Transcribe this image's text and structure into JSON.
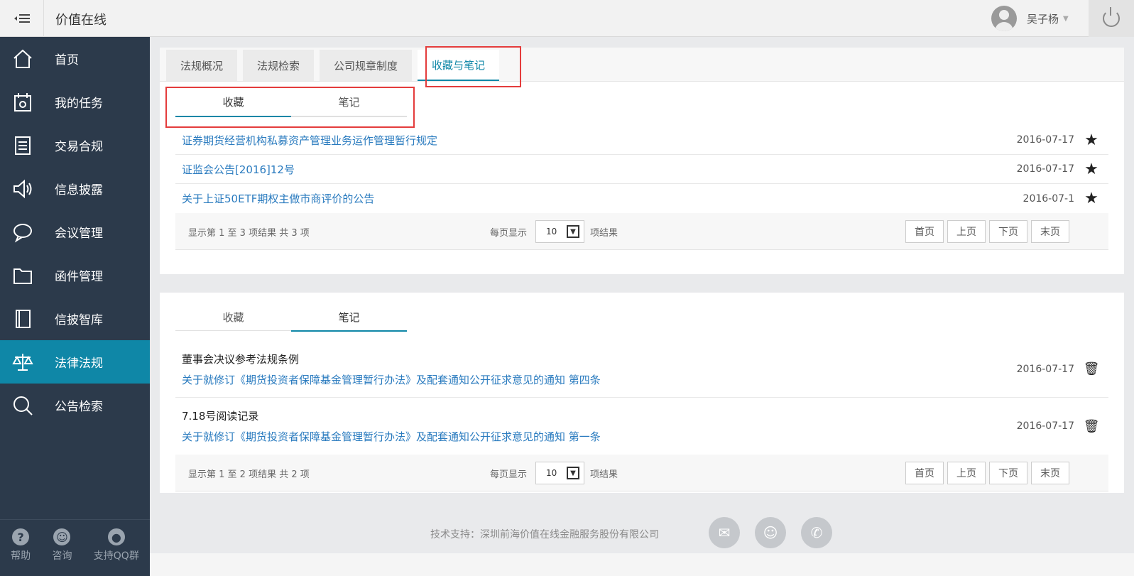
{
  "header": {
    "brand": "价值在线",
    "user_name": "吴子杨"
  },
  "sidebar": {
    "items": [
      {
        "label": "首页",
        "icon": "home-icon"
      },
      {
        "label": "我的任务",
        "icon": "calendar-icon"
      },
      {
        "label": "交易合规",
        "icon": "document-icon"
      },
      {
        "label": "信息披露",
        "icon": "speaker-icon"
      },
      {
        "label": "会议管理",
        "icon": "chat-icon"
      },
      {
        "label": "函件管理",
        "icon": "folder-icon"
      },
      {
        "label": "信披智库",
        "icon": "book-icon"
      },
      {
        "label": "法律法规",
        "icon": "scales-icon"
      },
      {
        "label": "公告检索",
        "icon": "search-icon"
      }
    ],
    "footer": {
      "help": "帮助",
      "consult": "咨询",
      "qq": "支持QQ群"
    }
  },
  "tabs": [
    "法规概况",
    "法规检索",
    "公司规章制度",
    "收藏与笔记"
  ],
  "subtabs": {
    "fav": "收藏",
    "note": "笔记"
  },
  "favorites": [
    {
      "title": "证券期货经营机构私募资产管理业务运作管理暂行规定",
      "date": "2016-07-17"
    },
    {
      "title": "证监会公告[2016]12号",
      "date": "2016-07-17"
    },
    {
      "title": "关于上证50ETF期权主做市商评价的公告",
      "date": "2016-07-1"
    }
  ],
  "pager1": {
    "info": "显示第 1 至 3 项结果  共 3 项",
    "per_label": "每页显示",
    "per_value": "10",
    "res_label": "项结果",
    "first": "首页",
    "prev": "上页",
    "next": "下页",
    "last": "末页"
  },
  "notes": [
    {
      "title": "董事会决议参考法规条例",
      "link": "关于就修订《期货投资者保障基金管理暂行办法》及配套通知公开征求意见的通知  第四条",
      "date": "2016-07-17"
    },
    {
      "title": "7.18号阅读记录",
      "link": "关于就修订《期货投资者保障基金管理暂行办法》及配套通知公开征求意见的通知  第一条",
      "date": "2016-07-17"
    }
  ],
  "pager2": {
    "info": "显示第 1 至 2 项结果  共 2 项",
    "per_label": "每页显示",
    "per_value": "10",
    "res_label": "项结果",
    "first": "首页",
    "prev": "上页",
    "next": "下页",
    "last": "末页"
  },
  "footer": {
    "support": "技术支持：深圳前海价值在线金融服务股份有限公司"
  }
}
